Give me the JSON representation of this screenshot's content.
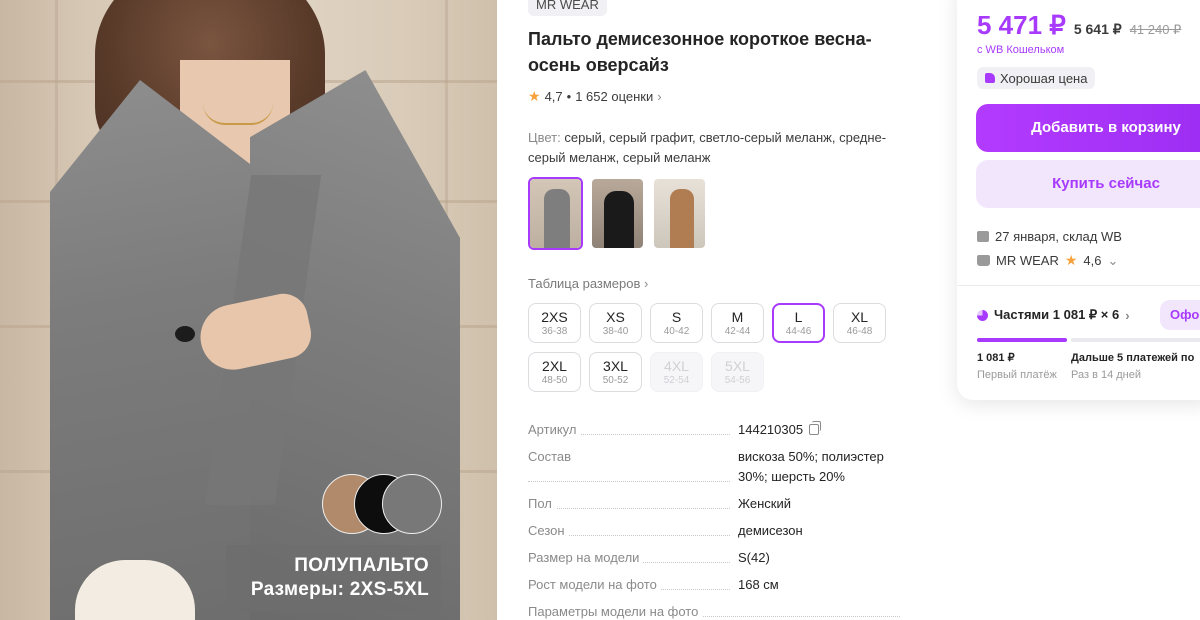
{
  "photo": {
    "caption_line1": "ПОЛУПАЛЬТО",
    "caption_line2": "Размеры: 2XS-5XL",
    "swatch_colors": [
      "#b08a6a",
      "#0d0d0d",
      "#787878"
    ]
  },
  "product": {
    "brand": "MR WEAR",
    "title": "Пальто демисезонное короткое весна-осень оверсайз",
    "rating": "4,7",
    "separator": "•",
    "reviews": "1 652 оценки",
    "color_label": "Цвет:",
    "color_value": "серый, серый графит, светло-серый меланж, средне-серый меланж, серый меланж",
    "size_table_link": "Таблица размеров",
    "sizes": [
      {
        "name": "2XS",
        "ru": "36-38",
        "state": "available"
      },
      {
        "name": "XS",
        "ru": "38-40",
        "state": "available"
      },
      {
        "name": "S",
        "ru": "40-42",
        "state": "available"
      },
      {
        "name": "M",
        "ru": "42-44",
        "state": "available"
      },
      {
        "name": "L",
        "ru": "44-46",
        "state": "selected"
      },
      {
        "name": "XL",
        "ru": "46-48",
        "state": "available"
      },
      {
        "name": "2XL",
        "ru": "48-50",
        "state": "available"
      },
      {
        "name": "3XL",
        "ru": "50-52",
        "state": "available"
      },
      {
        "name": "4XL",
        "ru": "52-54",
        "state": "disabled"
      },
      {
        "name": "5XL",
        "ru": "54-56",
        "state": "disabled"
      }
    ],
    "specs": [
      {
        "key": "Артикул",
        "value": "144210305"
      },
      {
        "key": "Состав",
        "value": "вискоза 50%; полиэстер 30%; шерсть 20%"
      },
      {
        "key": "Пол",
        "value": "Женский"
      },
      {
        "key": "Сезон",
        "value": "демисезон"
      },
      {
        "key": "Размер на модели",
        "value": "S(42)"
      },
      {
        "key": "Рост модели на фото",
        "value": "168 см"
      },
      {
        "key": "Параметры модели на фото",
        "value": ""
      }
    ]
  },
  "buy": {
    "price": "5 471 ₽",
    "price_old": "5 641 ₽",
    "price_crossed": "41 240 ₽",
    "wallet_note": "с WB Кошельком",
    "good_price": "Хорошая цена",
    "add_to_cart": "Добавить в корзину",
    "buy_now": "Купить сейчас",
    "delivery": "27 января, склад WB",
    "seller_name": "MR WEAR",
    "seller_rating": "4,6",
    "installments": "Частями 1 081 ₽ × 6",
    "offer_label": "Офо",
    "progress_paid_segments": 1,
    "progress_total_segments": 2,
    "first_payment_amount": "1 081 ₽",
    "first_payment_label": "Первый платёж",
    "next_payments_title": "Дальше 5 платежей по",
    "next_payments_interval": "Раз в 14 дней"
  },
  "colors": {
    "accent": "#a73afd",
    "accent_light": "#f2e6fd",
    "star": "#f8a23c"
  }
}
